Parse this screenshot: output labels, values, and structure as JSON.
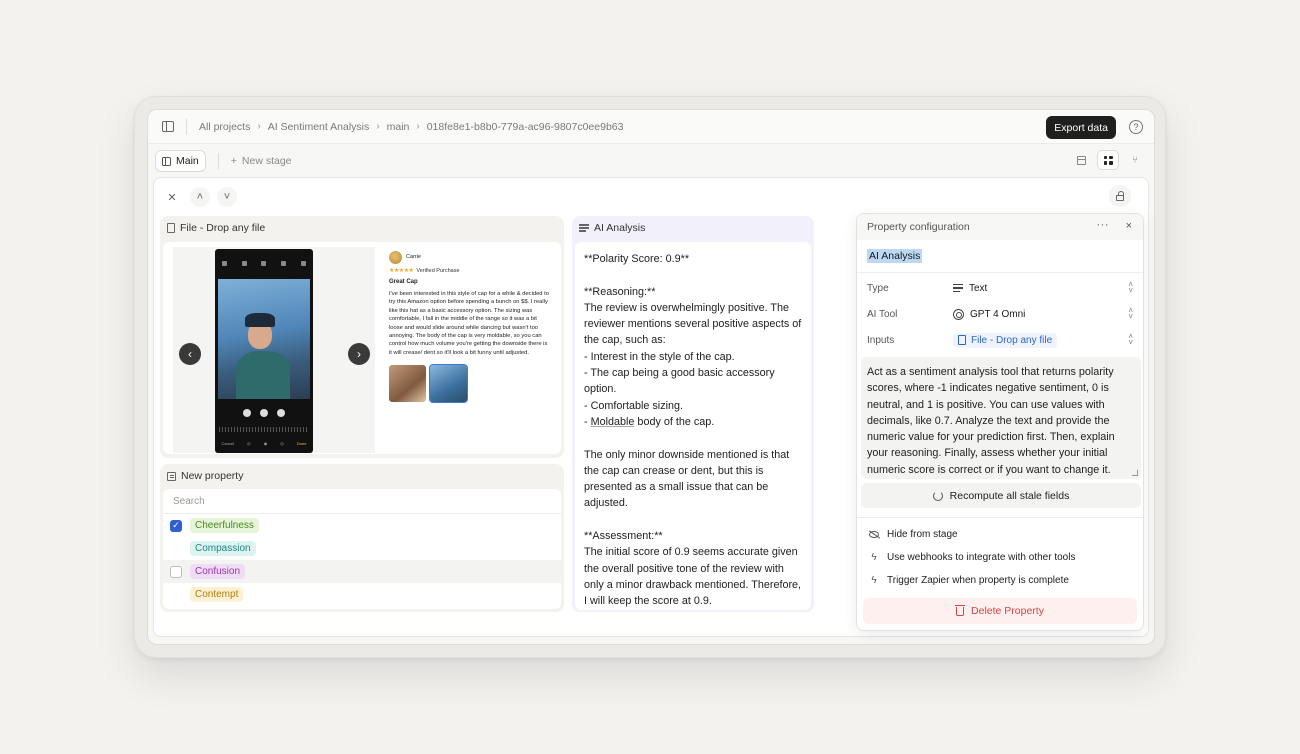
{
  "breadcrumb": [
    "All projects",
    "AI Sentiment Analysis",
    "main",
    "018fe8e1-b8b0-779a-ac96-9807c0ee9b63"
  ],
  "header": {
    "export_label": "Export data",
    "help_icon": "?"
  },
  "tabs": {
    "main_label": "Main",
    "new_stage_label": "New stage"
  },
  "file_card": {
    "title": "File - Drop any file",
    "review": {
      "reviewer": "Carrie",
      "stars": "★★★★★",
      "verified": "Verified Purchase",
      "title": "Great Cap",
      "text": "I've been interested in this style of cap for a while & decided to try this Amazon option before spending a bunch on $$. I really like this hat as a basic accessory option. The sizing was comfortable, I fall in the middle of the range so it was a bit loose and would slide around while dancing but wasn't too annoying. The body of the cap is very moldable, so you can control how much volume you're getting the downside there is it will crease/ dent so it'll look a bit funny until adjusted."
    },
    "phone_labels": {
      "cancel": "Cancel",
      "done": "Done"
    }
  },
  "new_property": {
    "title": "New property",
    "search_placeholder": "Search",
    "options": [
      {
        "label": "Cheerfulness",
        "state": "checked",
        "bg": "#e6f4d9",
        "fg": "#4c8a1f"
      },
      {
        "label": "Compassion",
        "state": "none",
        "bg": "#ddf3f1",
        "fg": "#1f8a80"
      },
      {
        "label": "Confusion",
        "state": "empty",
        "bg": "#efdcf5",
        "fg": "#9a36b8"
      },
      {
        "label": "Contempt",
        "state": "none",
        "bg": "#fcf1d3",
        "fg": "#b07d10"
      }
    ]
  },
  "ai_analysis": {
    "title": "AI Analysis",
    "text_before": "**Polarity Score: 0.9**\n\n**Reasoning:**\nThe review is overwhelmingly positive. The reviewer mentions several positive aspects of the cap, such as:\n- Interest in the style of the cap.\n- The cap being a good basic accessory option.\n- Comfortable sizing.\n- ",
    "underlined_word": "Moldable",
    "text_after": " body of the cap.\n\nThe only minor downside mentioned is that the cap can crease or dent, but this is presented as a small issue that can be adjusted.\n\n**Assessment:**\nThe initial score of 0.9 seems accurate given the overall positive tone of the review with only a minor drawback mentioned. Therefore, I will keep the score at 0.9."
  },
  "property_config": {
    "title": "Property configuration",
    "more_icon": "···",
    "close_icon": "×",
    "name": "AI Analysis",
    "type_label": "Type",
    "type_value": "Text",
    "tool_label": "AI Tool",
    "tool_value": "GPT 4 Omni",
    "inputs_label": "Inputs",
    "inputs_value": "File - Drop any file",
    "prompt": "Act as a sentiment analysis tool that returns polarity scores, where -1 indicates negative sentiment, 0 is neutral, and 1 is positive. You can use values with decimals, like 0.7. Analyze the text and provide the numeric value for your prediction first. Then, explain your reasoning. Finally, assess whether your initial numeric score is correct or if you want to change it.",
    "recompute_label": "Recompute all stale fields",
    "actions": [
      "Hide from stage",
      "Use webhooks to integrate with other tools",
      "Trigger Zapier when property is complete"
    ],
    "delete_label": "Delete Property"
  }
}
